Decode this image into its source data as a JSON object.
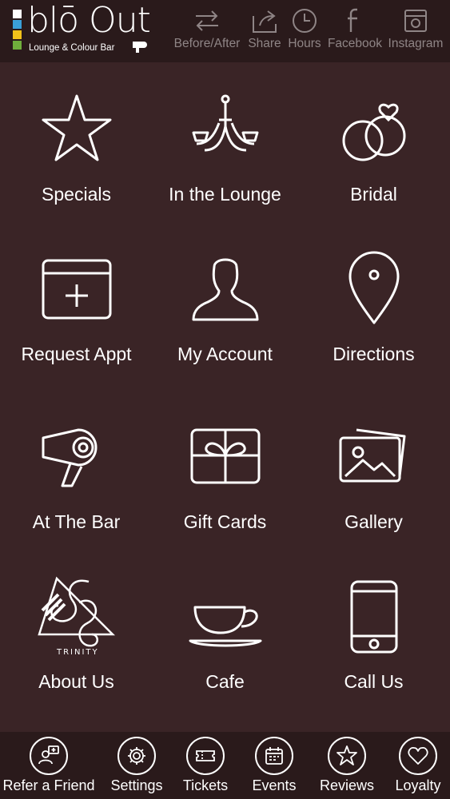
{
  "app": {
    "logo_text": "blō Out",
    "logo_subtitle": "Lounge & Colour Bar",
    "logo_colors": [
      "#ffffff",
      "#3aa0d8",
      "#f2c21a",
      "#6fae3c"
    ]
  },
  "top_actions": [
    {
      "label": "Before/After",
      "icon": "arrows-swap-icon"
    },
    {
      "label": "Share",
      "icon": "share-icon"
    },
    {
      "label": "Hours",
      "icon": "clock-icon"
    },
    {
      "label": "Facebook",
      "icon": "facebook-icon"
    },
    {
      "label": "Instagram",
      "icon": "instagram-icon"
    }
  ],
  "tiles": [
    {
      "label": "Specials",
      "icon": "star-icon"
    },
    {
      "label": "In the Lounge",
      "icon": "chandelier-icon"
    },
    {
      "label": "Bridal",
      "icon": "rings-icon"
    },
    {
      "label": "Request Appt",
      "icon": "calendar-plus-icon"
    },
    {
      "label": "My Account",
      "icon": "user-icon"
    },
    {
      "label": "Directions",
      "icon": "map-pin-icon"
    },
    {
      "label": "At The Bar",
      "icon": "hair-dryer-icon"
    },
    {
      "label": "Gift Cards",
      "icon": "gift-icon"
    },
    {
      "label": "Gallery",
      "icon": "photos-icon"
    },
    {
      "label": "About Us",
      "icon": "trinity-logo-icon",
      "logo_text": "TRINITY"
    },
    {
      "label": "Cafe",
      "icon": "coffee-cup-icon"
    },
    {
      "label": "Call Us",
      "icon": "phone-icon"
    }
  ],
  "bottom_nav": [
    {
      "label": "Refer a Friend",
      "icon": "refer-icon"
    },
    {
      "label": "Settings",
      "icon": "gear-icon"
    },
    {
      "label": "Tickets",
      "icon": "ticket-icon"
    },
    {
      "label": "Events",
      "icon": "calendar-icon"
    },
    {
      "label": "Reviews",
      "icon": "star-icon"
    },
    {
      "label": "Loyalty",
      "icon": "heart-icon"
    }
  ]
}
